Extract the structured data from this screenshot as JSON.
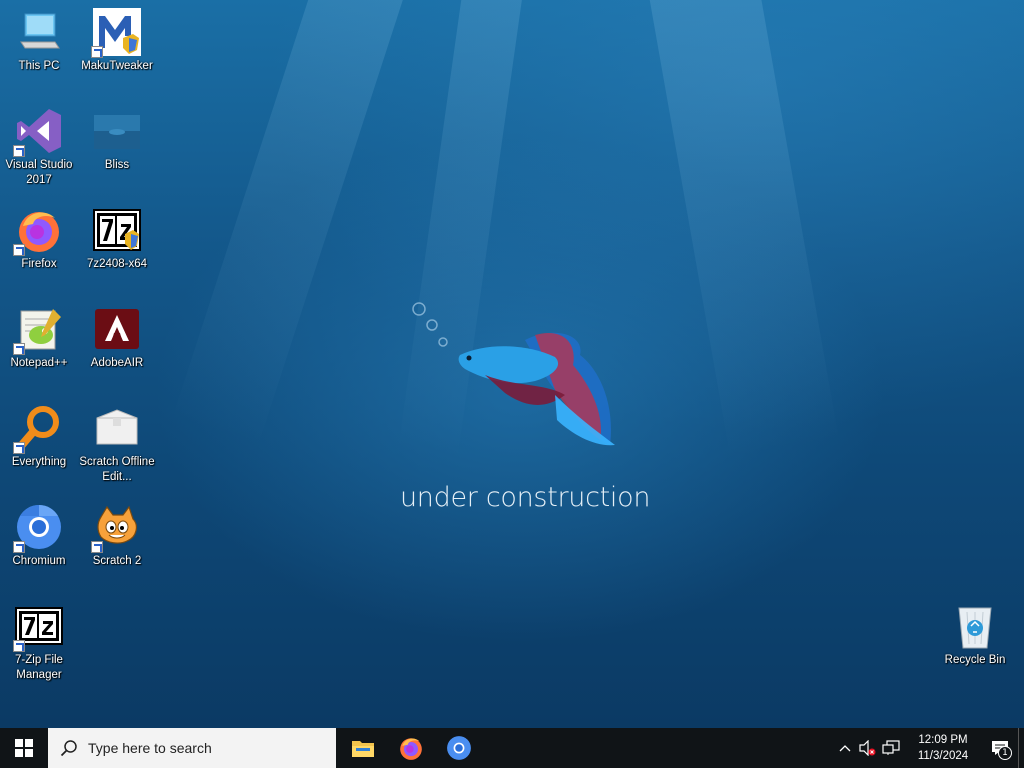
{
  "desktop": {
    "wallpaper_text": "under construction",
    "icons": [
      {
        "label": "This PC",
        "icon": "this-pc-icon"
      },
      {
        "label": "MakuTweaker",
        "icon": "makutweaker-icon"
      },
      {
        "label": "Visual Studio 2017",
        "icon": "visual-studio-icon"
      },
      {
        "label": "Bliss",
        "icon": "bliss-icon"
      },
      {
        "label": "Firefox",
        "icon": "firefox-icon"
      },
      {
        "label": "7z2408-x64",
        "icon": "7zip-installer-icon"
      },
      {
        "label": "Notepad++",
        "icon": "notepadpp-icon"
      },
      {
        "label": "AdobeAIR",
        "icon": "adobe-air-icon"
      },
      {
        "label": "Everything",
        "icon": "everything-icon"
      },
      {
        "label": "Scratch Offline Edit...",
        "icon": "scratch-box-icon"
      },
      {
        "label": "Chromium",
        "icon": "chromium-icon"
      },
      {
        "label": "Scratch 2",
        "icon": "scratch-cat-icon"
      },
      {
        "label": "7-Zip File Manager",
        "icon": "7zip-icon"
      },
      {
        "label": "Recycle Bin",
        "icon": "recycle-bin-icon"
      }
    ]
  },
  "taskbar": {
    "search_placeholder": "Type here to search",
    "pinned": [
      {
        "name": "File Explorer",
        "icon": "file-explorer-icon"
      },
      {
        "name": "Firefox",
        "icon": "firefox-icon"
      },
      {
        "name": "Chromium",
        "icon": "chromium-icon"
      }
    ],
    "clock": {
      "time": "12:09 PM",
      "date": "11/3/2024"
    },
    "notifications_count": "1"
  },
  "colors": {
    "taskbar_bg": "#101417",
    "search_bg": "#f3f3f3",
    "wallpaper_top": "#1a6fa6",
    "wallpaper_bottom": "#0b3a64"
  }
}
